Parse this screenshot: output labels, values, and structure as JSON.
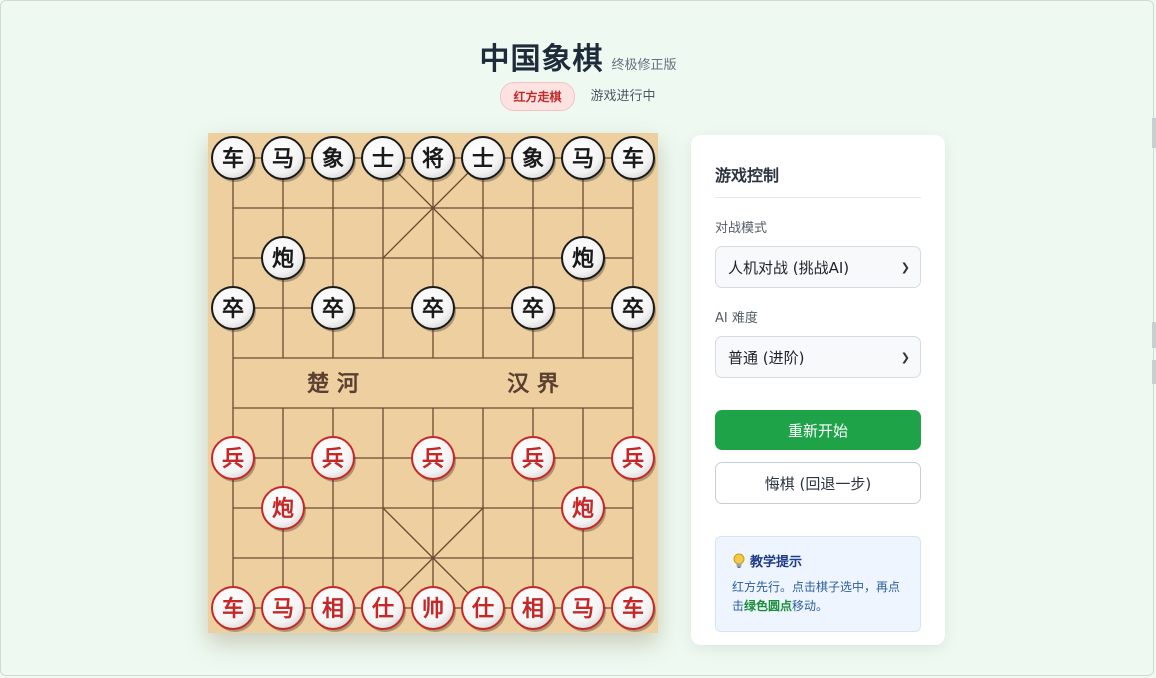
{
  "header": {
    "title": "中国象棋",
    "subtitle": "终极修正版",
    "turn_badge": "红方走棋",
    "game_status": "游戏进行中"
  },
  "board": {
    "river_left": "楚 河",
    "river_right": "汉 界",
    "colors": {
      "board": "#eecf9f",
      "line": "#6b4a32",
      "red": "#c62828",
      "black": "#1a1a1a"
    },
    "pieces": [
      {
        "text": "车",
        "side": "black",
        "col": 0,
        "row": 0
      },
      {
        "text": "马",
        "side": "black",
        "col": 1,
        "row": 0
      },
      {
        "text": "象",
        "side": "black",
        "col": 2,
        "row": 0
      },
      {
        "text": "士",
        "side": "black",
        "col": 3,
        "row": 0
      },
      {
        "text": "将",
        "side": "black",
        "col": 4,
        "row": 0
      },
      {
        "text": "士",
        "side": "black",
        "col": 5,
        "row": 0
      },
      {
        "text": "象",
        "side": "black",
        "col": 6,
        "row": 0
      },
      {
        "text": "马",
        "side": "black",
        "col": 7,
        "row": 0
      },
      {
        "text": "车",
        "side": "black",
        "col": 8,
        "row": 0
      },
      {
        "text": "炮",
        "side": "black",
        "col": 1,
        "row": 2
      },
      {
        "text": "炮",
        "side": "black",
        "col": 7,
        "row": 2
      },
      {
        "text": "卒",
        "side": "black",
        "col": 0,
        "row": 3
      },
      {
        "text": "卒",
        "side": "black",
        "col": 2,
        "row": 3
      },
      {
        "text": "卒",
        "side": "black",
        "col": 4,
        "row": 3
      },
      {
        "text": "卒",
        "side": "black",
        "col": 6,
        "row": 3
      },
      {
        "text": "卒",
        "side": "black",
        "col": 8,
        "row": 3
      },
      {
        "text": "兵",
        "side": "red",
        "col": 0,
        "row": 6
      },
      {
        "text": "兵",
        "side": "red",
        "col": 2,
        "row": 6
      },
      {
        "text": "兵",
        "side": "red",
        "col": 4,
        "row": 6
      },
      {
        "text": "兵",
        "side": "red",
        "col": 6,
        "row": 6
      },
      {
        "text": "兵",
        "side": "red",
        "col": 8,
        "row": 6
      },
      {
        "text": "炮",
        "side": "red",
        "col": 1,
        "row": 7
      },
      {
        "text": "炮",
        "side": "red",
        "col": 7,
        "row": 7
      },
      {
        "text": "车",
        "side": "red",
        "col": 0,
        "row": 9
      },
      {
        "text": "马",
        "side": "red",
        "col": 1,
        "row": 9
      },
      {
        "text": "相",
        "side": "red",
        "col": 2,
        "row": 9
      },
      {
        "text": "仕",
        "side": "red",
        "col": 3,
        "row": 9
      },
      {
        "text": "帅",
        "side": "red",
        "col": 4,
        "row": 9
      },
      {
        "text": "仕",
        "side": "red",
        "col": 5,
        "row": 9
      },
      {
        "text": "相",
        "side": "red",
        "col": 6,
        "row": 9
      },
      {
        "text": "马",
        "side": "red",
        "col": 7,
        "row": 9
      },
      {
        "text": "车",
        "side": "red",
        "col": 8,
        "row": 9
      }
    ]
  },
  "panel": {
    "title": "游戏控制",
    "mode_label": "对战模式",
    "mode_value": "人机对战 (挑战AI)",
    "difficulty_label": "AI 难度",
    "difficulty_value": "普通 (进阶)",
    "restart_label": "重新开始",
    "undo_label": "悔棋 (回退一步)",
    "tip_icon": "lightbulb-icon",
    "tip_title": "教学提示",
    "tip_text_1": "红方先行。点击棋子选中，再点击",
    "tip_text_green": "绿色圆点",
    "tip_text_2": "移动。"
  }
}
